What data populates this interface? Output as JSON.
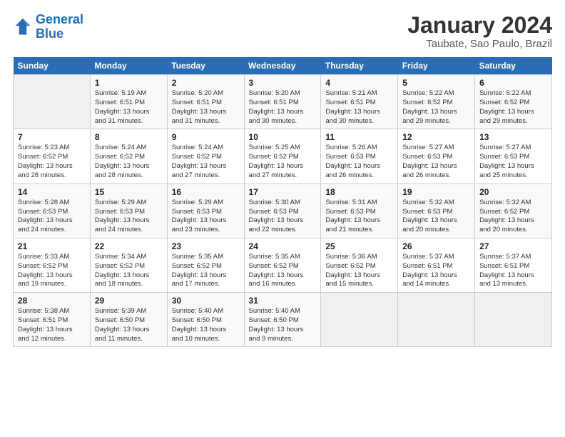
{
  "logo": {
    "line1": "General",
    "line2": "Blue"
  },
  "title": "January 2024",
  "subtitle": "Taubate, Sao Paulo, Brazil",
  "header_days": [
    "Sunday",
    "Monday",
    "Tuesday",
    "Wednesday",
    "Thursday",
    "Friday",
    "Saturday"
  ],
  "weeks": [
    [
      {
        "num": "",
        "sunrise": "",
        "sunset": "",
        "daylight": ""
      },
      {
        "num": "1",
        "sunrise": "Sunrise: 5:19 AM",
        "sunset": "Sunset: 6:51 PM",
        "daylight": "Daylight: 13 hours and 31 minutes."
      },
      {
        "num": "2",
        "sunrise": "Sunrise: 5:20 AM",
        "sunset": "Sunset: 6:51 PM",
        "daylight": "Daylight: 13 hours and 31 minutes."
      },
      {
        "num": "3",
        "sunrise": "Sunrise: 5:20 AM",
        "sunset": "Sunset: 6:51 PM",
        "daylight": "Daylight: 13 hours and 30 minutes."
      },
      {
        "num": "4",
        "sunrise": "Sunrise: 5:21 AM",
        "sunset": "Sunset: 6:51 PM",
        "daylight": "Daylight: 13 hours and 30 minutes."
      },
      {
        "num": "5",
        "sunrise": "Sunrise: 5:22 AM",
        "sunset": "Sunset: 6:52 PM",
        "daylight": "Daylight: 13 hours and 29 minutes."
      },
      {
        "num": "6",
        "sunrise": "Sunrise: 5:22 AM",
        "sunset": "Sunset: 6:52 PM",
        "daylight": "Daylight: 13 hours and 29 minutes."
      }
    ],
    [
      {
        "num": "7",
        "sunrise": "Sunrise: 5:23 AM",
        "sunset": "Sunset: 6:52 PM",
        "daylight": "Daylight: 13 hours and 28 minutes."
      },
      {
        "num": "8",
        "sunrise": "Sunrise: 5:24 AM",
        "sunset": "Sunset: 6:52 PM",
        "daylight": "Daylight: 13 hours and 28 minutes."
      },
      {
        "num": "9",
        "sunrise": "Sunrise: 5:24 AM",
        "sunset": "Sunset: 6:52 PM",
        "daylight": "Daylight: 13 hours and 27 minutes."
      },
      {
        "num": "10",
        "sunrise": "Sunrise: 5:25 AM",
        "sunset": "Sunset: 6:52 PM",
        "daylight": "Daylight: 13 hours and 27 minutes."
      },
      {
        "num": "11",
        "sunrise": "Sunrise: 5:26 AM",
        "sunset": "Sunset: 6:53 PM",
        "daylight": "Daylight: 13 hours and 26 minutes."
      },
      {
        "num": "12",
        "sunrise": "Sunrise: 5:27 AM",
        "sunset": "Sunset: 6:53 PM",
        "daylight": "Daylight: 13 hours and 26 minutes."
      },
      {
        "num": "13",
        "sunrise": "Sunrise: 5:27 AM",
        "sunset": "Sunset: 6:53 PM",
        "daylight": "Daylight: 13 hours and 25 minutes."
      }
    ],
    [
      {
        "num": "14",
        "sunrise": "Sunrise: 5:28 AM",
        "sunset": "Sunset: 6:53 PM",
        "daylight": "Daylight: 13 hours and 24 minutes."
      },
      {
        "num": "15",
        "sunrise": "Sunrise: 5:29 AM",
        "sunset": "Sunset: 6:53 PM",
        "daylight": "Daylight: 13 hours and 24 minutes."
      },
      {
        "num": "16",
        "sunrise": "Sunrise: 5:29 AM",
        "sunset": "Sunset: 6:53 PM",
        "daylight": "Daylight: 13 hours and 23 minutes."
      },
      {
        "num": "17",
        "sunrise": "Sunrise: 5:30 AM",
        "sunset": "Sunset: 6:53 PM",
        "daylight": "Daylight: 13 hours and 22 minutes."
      },
      {
        "num": "18",
        "sunrise": "Sunrise: 5:31 AM",
        "sunset": "Sunset: 6:53 PM",
        "daylight": "Daylight: 13 hours and 21 minutes."
      },
      {
        "num": "19",
        "sunrise": "Sunrise: 5:32 AM",
        "sunset": "Sunset: 6:53 PM",
        "daylight": "Daylight: 13 hours and 20 minutes."
      },
      {
        "num": "20",
        "sunrise": "Sunrise: 5:32 AM",
        "sunset": "Sunset: 6:52 PM",
        "daylight": "Daylight: 13 hours and 20 minutes."
      }
    ],
    [
      {
        "num": "21",
        "sunrise": "Sunrise: 5:33 AM",
        "sunset": "Sunset: 6:52 PM",
        "daylight": "Daylight: 13 hours and 19 minutes."
      },
      {
        "num": "22",
        "sunrise": "Sunrise: 5:34 AM",
        "sunset": "Sunset: 6:52 PM",
        "daylight": "Daylight: 13 hours and 18 minutes."
      },
      {
        "num": "23",
        "sunrise": "Sunrise: 5:35 AM",
        "sunset": "Sunset: 6:52 PM",
        "daylight": "Daylight: 13 hours and 17 minutes."
      },
      {
        "num": "24",
        "sunrise": "Sunrise: 5:35 AM",
        "sunset": "Sunset: 6:52 PM",
        "daylight": "Daylight: 13 hours and 16 minutes."
      },
      {
        "num": "25",
        "sunrise": "Sunrise: 5:36 AM",
        "sunset": "Sunset: 6:52 PM",
        "daylight": "Daylight: 13 hours and 15 minutes."
      },
      {
        "num": "26",
        "sunrise": "Sunrise: 5:37 AM",
        "sunset": "Sunset: 6:51 PM",
        "daylight": "Daylight: 13 hours and 14 minutes."
      },
      {
        "num": "27",
        "sunrise": "Sunrise: 5:37 AM",
        "sunset": "Sunset: 6:51 PM",
        "daylight": "Daylight: 13 hours and 13 minutes."
      }
    ],
    [
      {
        "num": "28",
        "sunrise": "Sunrise: 5:38 AM",
        "sunset": "Sunset: 6:51 PM",
        "daylight": "Daylight: 13 hours and 12 minutes."
      },
      {
        "num": "29",
        "sunrise": "Sunrise: 5:39 AM",
        "sunset": "Sunset: 6:50 PM",
        "daylight": "Daylight: 13 hours and 11 minutes."
      },
      {
        "num": "30",
        "sunrise": "Sunrise: 5:40 AM",
        "sunset": "Sunset: 6:50 PM",
        "daylight": "Daylight: 13 hours and 10 minutes."
      },
      {
        "num": "31",
        "sunrise": "Sunrise: 5:40 AM",
        "sunset": "Sunset: 6:50 PM",
        "daylight": "Daylight: 13 hours and 9 minutes."
      },
      {
        "num": "",
        "sunrise": "",
        "sunset": "",
        "daylight": ""
      },
      {
        "num": "",
        "sunrise": "",
        "sunset": "",
        "daylight": ""
      },
      {
        "num": "",
        "sunrise": "",
        "sunset": "",
        "daylight": ""
      }
    ]
  ]
}
